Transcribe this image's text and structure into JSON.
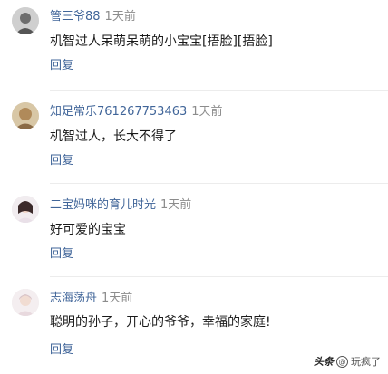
{
  "comments": [
    {
      "username": "管三爷88",
      "time": "1天前",
      "text": "机智过人呆萌呆萌的小宝宝[捂脸][捂脸]",
      "reply": "回复"
    },
    {
      "username": "知足常乐761267753463",
      "time": "1天前",
      "text": "机智过人，长大不得了",
      "reply": "回复"
    },
    {
      "username": "二宝妈咪的育儿时光",
      "time": "1天前",
      "text": "好可爱的宝宝",
      "reply": "回复"
    },
    {
      "username": "志海荡舟",
      "time": "1天前",
      "text": "聪明的孙子，开心的爷爷，幸福的家庭!",
      "reply": "回复"
    }
  ],
  "watermark": {
    "brand": "头条",
    "at": "@",
    "handle": "玩疯了"
  }
}
